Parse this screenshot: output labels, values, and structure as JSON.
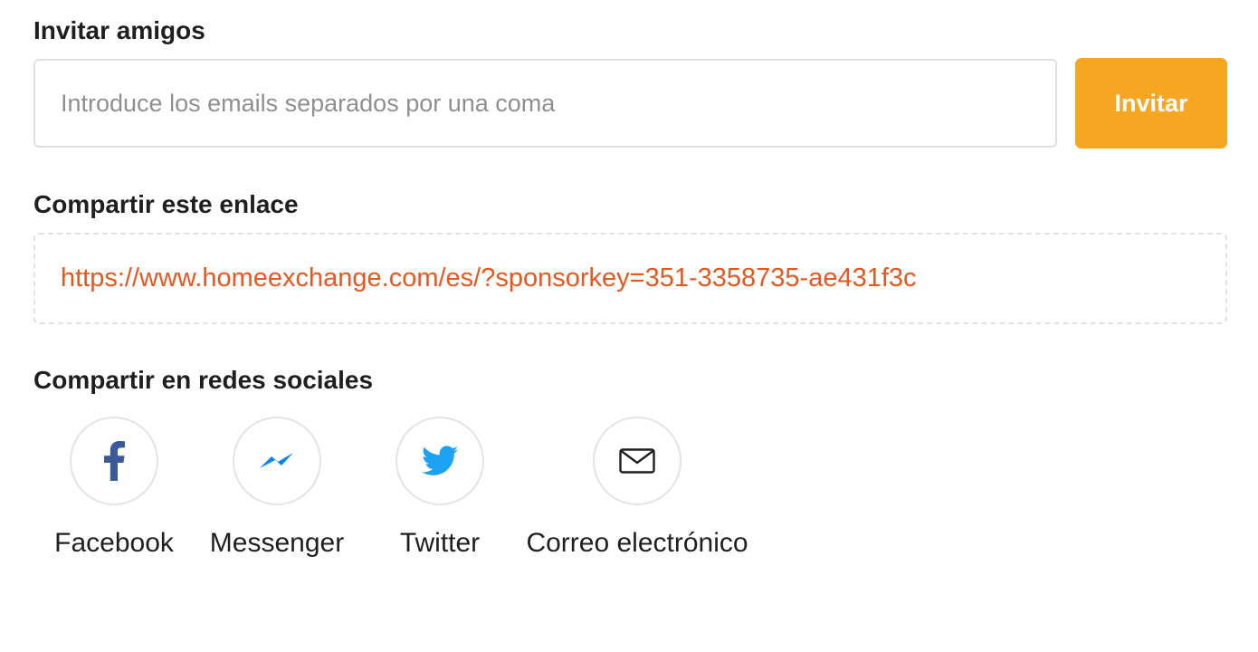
{
  "invite": {
    "title": "Invitar amigos",
    "email_placeholder": "Introduce los emails separados por una coma",
    "email_value": "",
    "button_label": "Invitar"
  },
  "share_link": {
    "title": "Compartir este enlace",
    "url": "https://www.homeexchange.com/es/?sponsorkey=351-3358735-ae431f3c"
  },
  "social": {
    "title": "Compartir en redes sociales",
    "items": [
      {
        "label": "Facebook",
        "icon": "facebook-icon",
        "color": "#3b5998"
      },
      {
        "label": "Messenger",
        "icon": "messenger-icon",
        "color": "#0084ff"
      },
      {
        "label": "Twitter",
        "icon": "twitter-icon",
        "color": "#1da1f2"
      },
      {
        "label": "Correo electrónico",
        "icon": "envelope-icon",
        "color": "#1f1f1f"
      }
    ]
  },
  "colors": {
    "accent": "#f6a623",
    "link": "#e8571e",
    "text": "#1f1f1f",
    "border": "#e0e0e0"
  }
}
